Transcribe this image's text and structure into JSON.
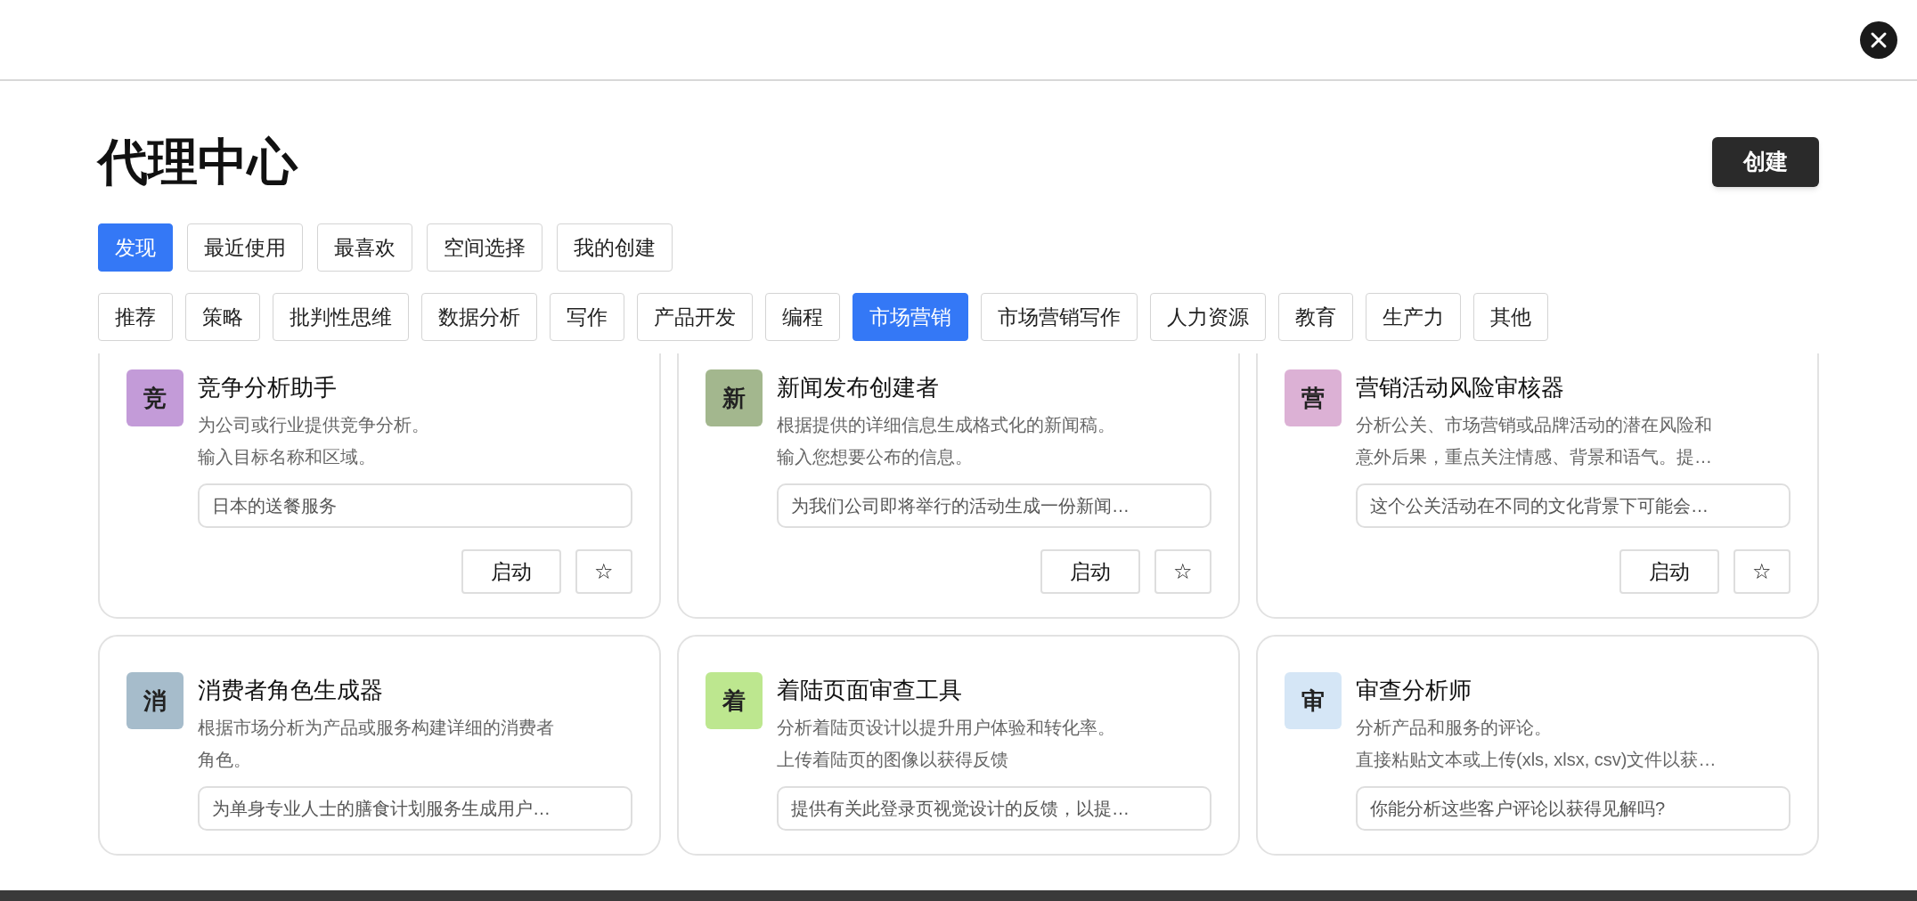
{
  "title": "代理中心",
  "create_button": "创建",
  "primary_tabs": [
    {
      "label": "发现",
      "selected": true
    },
    {
      "label": "最近使用",
      "selected": false
    },
    {
      "label": "最喜欢",
      "selected": false
    },
    {
      "label": "空间选择",
      "selected": false
    },
    {
      "label": "我的创建",
      "selected": false
    }
  ],
  "category_tabs": [
    {
      "label": "推荐",
      "selected": false
    },
    {
      "label": "策略",
      "selected": false
    },
    {
      "label": "批判性思维",
      "selected": false
    },
    {
      "label": "数据分析",
      "selected": false
    },
    {
      "label": "写作",
      "selected": false
    },
    {
      "label": "产品开发",
      "selected": false
    },
    {
      "label": "编程",
      "selected": false
    },
    {
      "label": "市场营销",
      "selected": true
    },
    {
      "label": "市场营销写作",
      "selected": false
    },
    {
      "label": "人力资源",
      "selected": false
    },
    {
      "label": "教育",
      "selected": false
    },
    {
      "label": "生产力",
      "selected": false
    },
    {
      "label": "其他",
      "selected": false
    }
  ],
  "agents": [
    {
      "badge": "竞",
      "color": "#c39bd8",
      "name": "竞争分析助手",
      "description": [
        "为公司或行业提供竞争分析。",
        "输入目标名称和区域。"
      ],
      "example": "日本的送餐服务",
      "launch": "启动",
      "favorite": "☆"
    },
    {
      "badge": "新",
      "color": "#a3b78e",
      "name": "新闻发布创建者",
      "description": [
        "根据提供的详细信息生成格式化的新闻稿。",
        "输入您想要公布的信息。"
      ],
      "example": "为我们公司即将举行的活动生成一份新闻…",
      "launch": "启动",
      "favorite": "☆"
    },
    {
      "badge": "营",
      "color": "#dcb1d5",
      "name": "营销活动风险审核器",
      "description": [
        "分析公关、市场营销或品牌活动的潜在风险和",
        "意外后果，重点关注情感、背景和语气。提…"
      ],
      "example": "这个公关活动在不同的文化背景下可能会…",
      "launch": "启动",
      "favorite": "☆"
    },
    {
      "badge": "消",
      "color": "#a6bccb",
      "name": "消费者角色生成器",
      "description": [
        "根据市场分析为产品或服务构建详细的消费者",
        "角色。"
      ],
      "example": "为单身专业人士的膳食计划服务生成用户…"
    },
    {
      "badge": "着",
      "color": "#bde78f",
      "name": "着陆页面审查工具",
      "description": [
        "分析着陆页设计以提升用户体验和转化率。",
        "上传着陆页的图像以获得反馈"
      ],
      "example": "提供有关此登录页视觉设计的反馈，以提…"
    },
    {
      "badge": "审",
      "color": "#d5e6f6",
      "name": "审查分析师",
      "description": [
        "分析产品和服务的评论。",
        "直接粘贴文本或上传(xls, xlsx, csv)文件以获…"
      ],
      "example": "你能分析这些客户评论以获得见解吗?"
    }
  ]
}
